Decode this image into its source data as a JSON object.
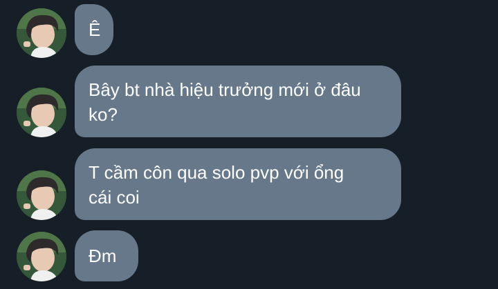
{
  "messages": [
    {
      "text": "Ê",
      "avatar": "user-avatar"
    },
    {
      "text": "Bây bt nhà hiệu trưởng mới ở đâu\nko?",
      "avatar": "user-avatar"
    },
    {
      "text": "T cầm côn qua solo pvp với ổng\ncái coi",
      "avatar": "user-avatar"
    },
    {
      "text": "Đm",
      "avatar": "user-avatar"
    }
  ],
  "colors": {
    "background": "#161e28",
    "bubble": "#66788a",
    "text": "#ffffff"
  }
}
